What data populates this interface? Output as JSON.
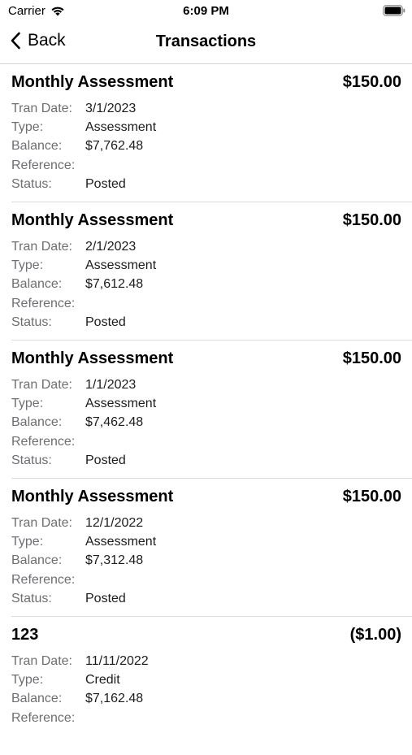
{
  "status_bar": {
    "carrier": "Carrier",
    "time": "6:09 PM"
  },
  "nav": {
    "back_label": "Back",
    "title": "Transactions"
  },
  "labels": {
    "tran_date": "Tran Date:",
    "type": "Type:",
    "balance": "Balance:",
    "reference": "Reference:",
    "status": "Status:"
  },
  "transactions": [
    {
      "description": "Monthly Assessment",
      "amount": "$150.00",
      "tran_date": "3/1/2023",
      "type": "Assessment",
      "balance": "$7,762.48",
      "reference": "",
      "status": "Posted"
    },
    {
      "description": "Monthly Assessment",
      "amount": "$150.00",
      "tran_date": "2/1/2023",
      "type": "Assessment",
      "balance": "$7,612.48",
      "reference": "",
      "status": "Posted"
    },
    {
      "description": "Monthly Assessment",
      "amount": "$150.00",
      "tran_date": "1/1/2023",
      "type": "Assessment",
      "balance": "$7,462.48",
      "reference": "",
      "status": "Posted"
    },
    {
      "description": "Monthly Assessment",
      "amount": "$150.00",
      "tran_date": "12/1/2022",
      "type": "Assessment",
      "balance": "$7,312.48",
      "reference": "",
      "status": "Posted"
    },
    {
      "description": "123",
      "amount": "($1.00)",
      "tran_date": "11/11/2022",
      "type": "Credit",
      "balance": "$7,162.48",
      "reference": ""
    }
  ]
}
